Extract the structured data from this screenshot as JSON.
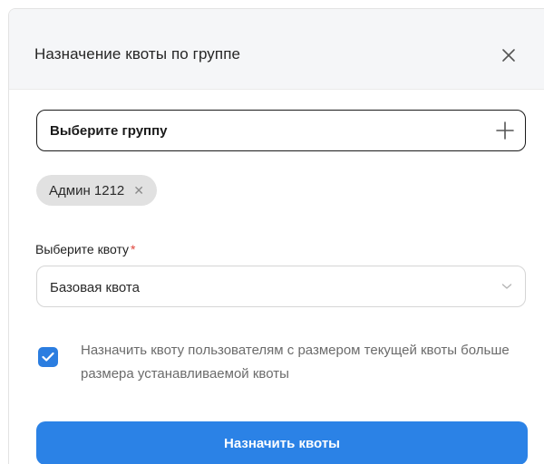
{
  "modal": {
    "title": "Назначение квоты по группе",
    "close_icon": "close-icon"
  },
  "group_picker": {
    "label": "Выберите группу",
    "add_icon": "plus-icon"
  },
  "selected_groups": [
    {
      "label": "Админ 1212",
      "remove_icon": "close-small-icon"
    }
  ],
  "quota_field": {
    "label": "Выберите квоту",
    "required_mark": "*",
    "selected_value": "Базовая квота",
    "dropdown_icon": "chevron-down-icon"
  },
  "assign_option": {
    "checked": true,
    "text": "Назначить квоту пользователям с размером текущей квоты больше размера устанавливаемой квоты"
  },
  "submit": {
    "label": "Назначить квоты"
  },
  "colors": {
    "accent": "#2b82e6",
    "required": "#e0443c",
    "chip_bg": "#e1e1e1",
    "header_bg": "#f5f6f8"
  }
}
